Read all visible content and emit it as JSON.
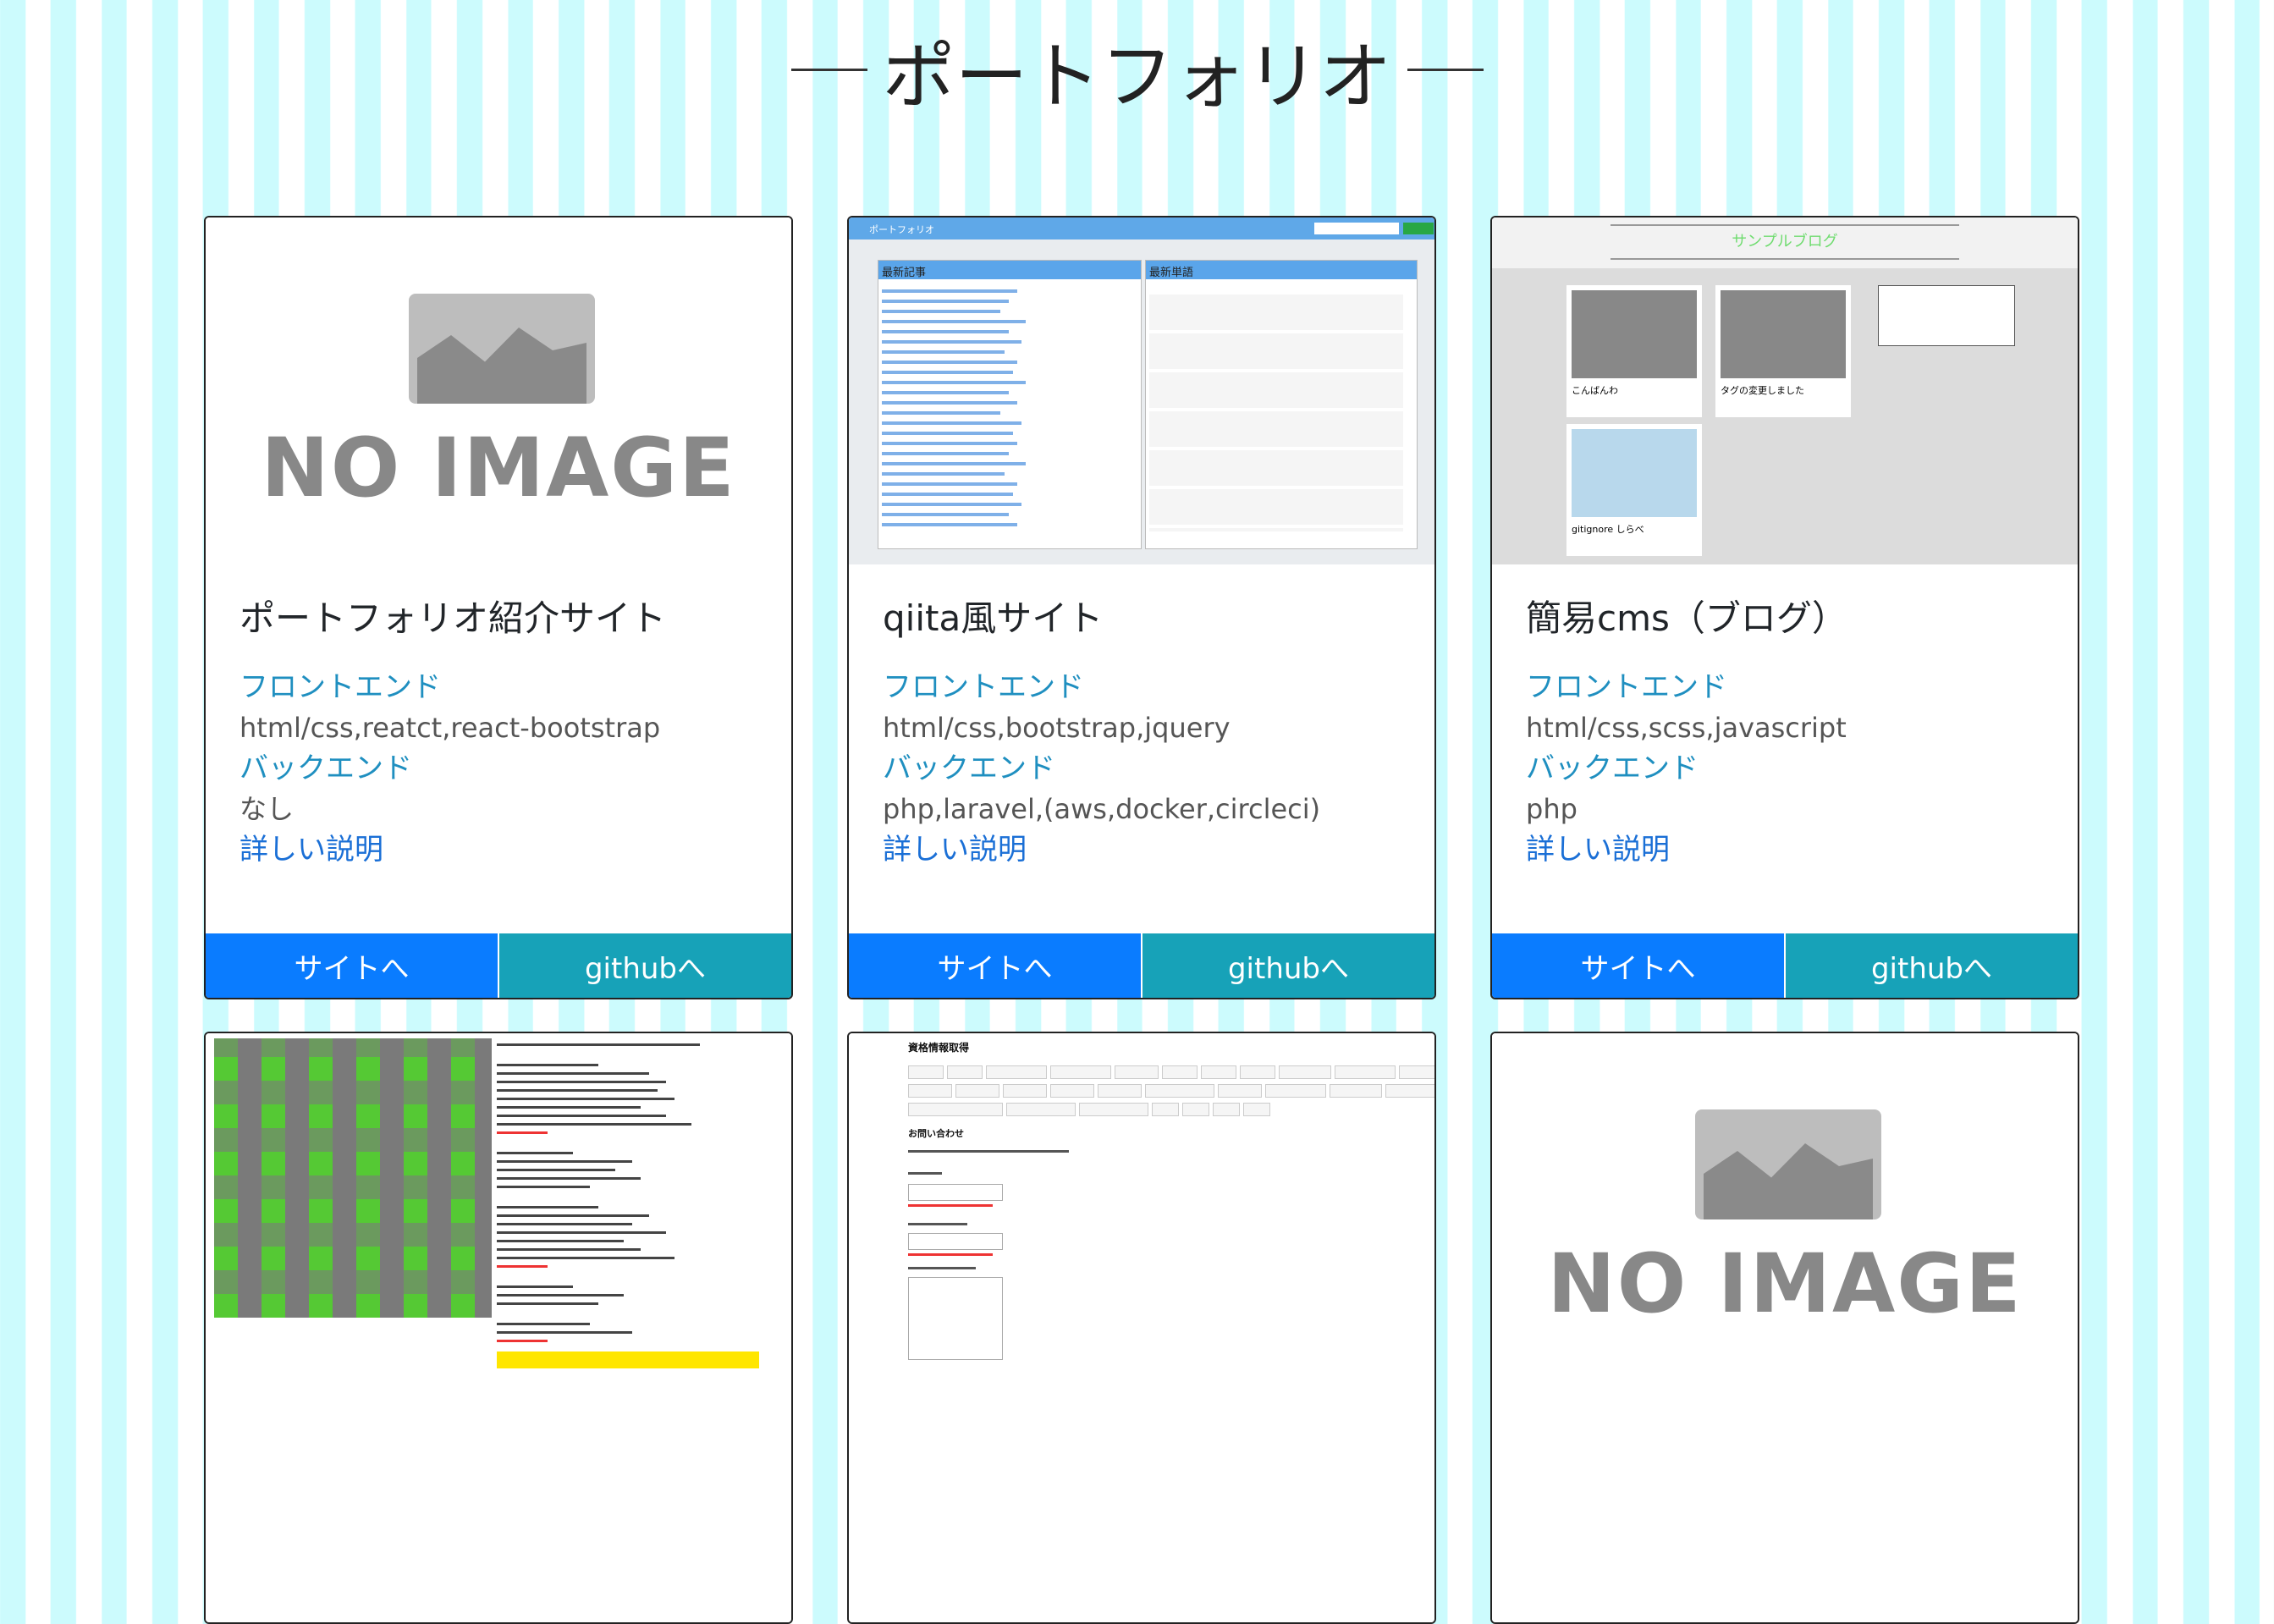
{
  "page": {
    "title": "ポートフォリオ"
  },
  "cards": [
    {
      "title": "ポートフォリオ紹介サイト",
      "frontend_label": "フロントエンド",
      "frontend": "html/css,reatct,react-bootstrap",
      "backend_label": "バックエンド",
      "backend": "なし",
      "detail": "詳しい説明",
      "site_button": "サイトへ",
      "github_button": "githubへ",
      "image": "NO IMAGE"
    },
    {
      "title": "qiita風サイト",
      "frontend_label": "フロントエンド",
      "frontend": "html/css,bootstrap,jquery",
      "backend_label": "バックエンド",
      "backend": "php,laravel,(aws,docker,circleci)",
      "detail": "詳しい説明",
      "site_button": "サイトへ",
      "github_button": "githubへ",
      "image": {
        "nav_title": "ポートフォリオ",
        "col1": "最新記事",
        "col2": "最新単語"
      }
    },
    {
      "title": "簡易cms（ブログ）",
      "frontend_label": "フロントエンド",
      "frontend": "html/css,scss,javascript",
      "backend_label": "バックエンド",
      "backend": "php",
      "detail": "詳しい説明",
      "site_button": "サイトへ",
      "github_button": "githubへ",
      "image": {
        "blog_title": "サンプルブログ",
        "posts": [
          "こんばんわ",
          "タグの変更しました",
          "gitignore しらべ"
        ]
      }
    }
  ],
  "bottom_cards": [
    {
      "image": "game"
    },
    {
      "image": {
        "heading": "資格情報取得",
        "contact": "お問い合わせ"
      }
    },
    {
      "image": "NO IMAGE"
    }
  ],
  "colors": {
    "stripe": "#ccfbfd",
    "site_button": "#0a7cff",
    "github_button": "#17a2b8",
    "link": "#1f8fc0"
  }
}
